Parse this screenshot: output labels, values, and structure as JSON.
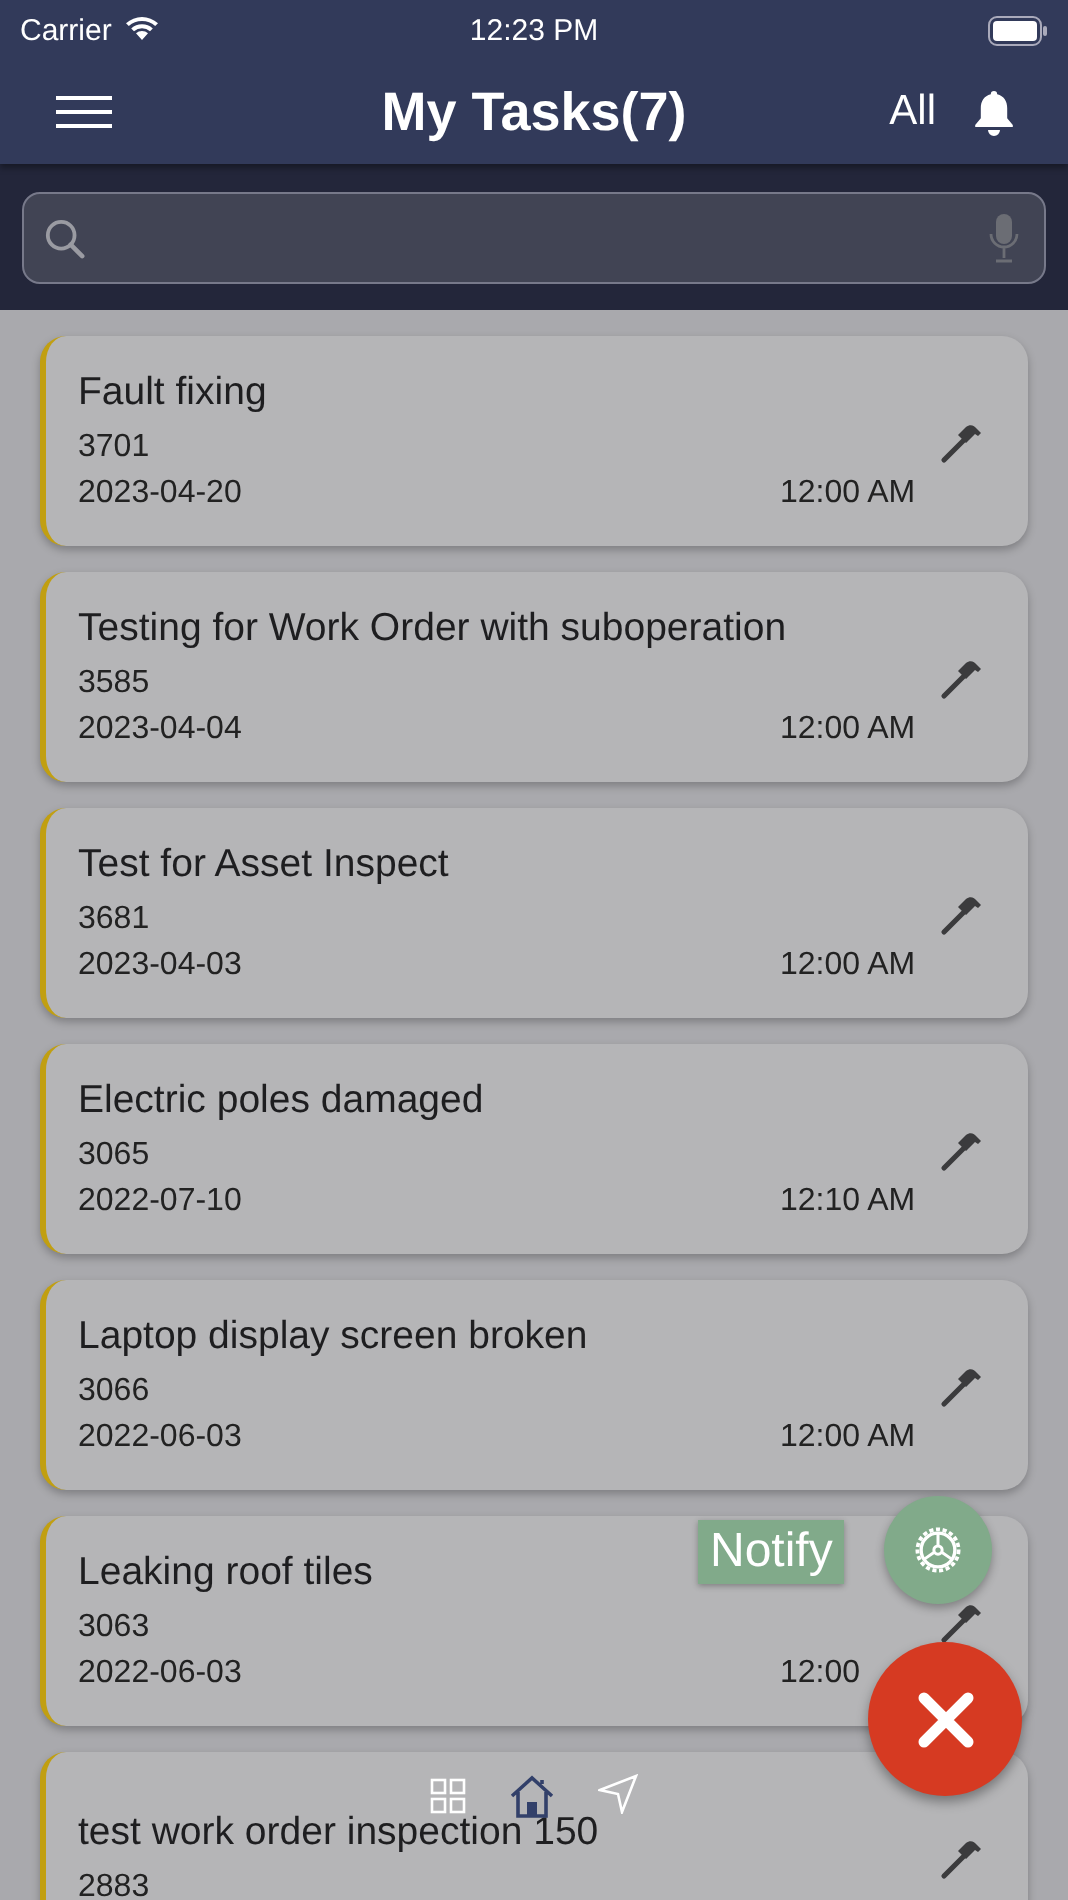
{
  "status_bar": {
    "carrier": "Carrier",
    "time": "12:23 PM"
  },
  "header": {
    "title": "My Tasks(7)",
    "filter": "All"
  },
  "tasks": [
    {
      "title": "Fault fixing",
      "number": "3701",
      "date": "2023-04-20",
      "time": "12:00 AM"
    },
    {
      "title": "Testing for Work Order with suboperation",
      "number": "3585",
      "date": "2023-04-04",
      "time": "12:00 AM"
    },
    {
      "title": "Test for Asset Inspect",
      "number": "3681",
      "date": "2023-04-03",
      "time": "12:00 AM"
    },
    {
      "title": "Electric poles damaged",
      "number": "3065",
      "date": "2022-07-10",
      "time": "12:10 AM"
    },
    {
      "title": "Laptop display screen broken",
      "number": "3066",
      "date": "2022-06-03",
      "time": "12:00 AM"
    },
    {
      "title": "Leaking roof tiles",
      "number": "3063",
      "date": "2022-06-03",
      "time": "12:00"
    },
    {
      "title": "test work order inspection 150",
      "number": "2883"
    }
  ],
  "fab_menu": {
    "label": "Notify"
  }
}
